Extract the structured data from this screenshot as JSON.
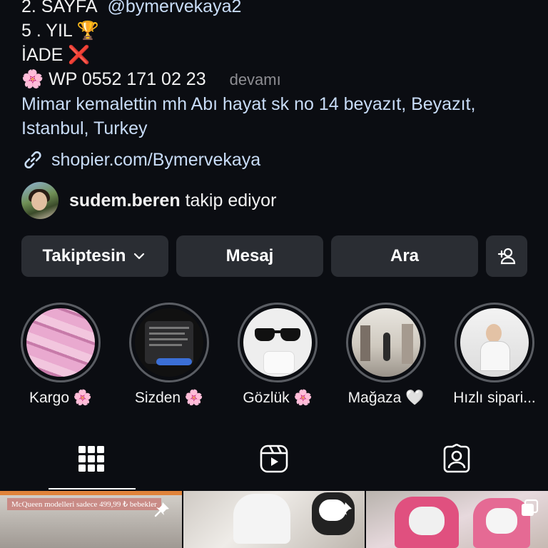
{
  "bio": {
    "line1_prefix": "2. SAYFA",
    "line1_handle": "@bymervekaya2",
    "line2": "5 . YIL 🏆",
    "line3": "İADE ❌",
    "line4_phone": "🌸 WP 0552 171 02 23",
    "line4_more": "devamı",
    "address": "Mimar kemalettin mh Abı hayat sk no 14 beyazıt, Beyazıt, Istanbul, Turkey",
    "link": "shopier.com/Bymervekaya"
  },
  "follower": {
    "username": "sudem.beren",
    "text": "takip ediyor"
  },
  "buttons": {
    "following": "Takiptesin",
    "message": "Mesaj",
    "call": "Ara"
  },
  "highlights": [
    {
      "label": "Kargo 🌸"
    },
    {
      "label": "Sizden 🌸"
    },
    {
      "label": "Gözlük 🌸"
    },
    {
      "label": "Mağaza 🤍"
    },
    {
      "label": "Hızlı sipari..."
    }
  ],
  "grid": {
    "post1_caption": "McQueen modelleri sadece 499,99 ₺ bebekler"
  },
  "colors": {
    "background": "#0b0d12",
    "link": "#c8dcf7",
    "button": "#2a2d33"
  }
}
